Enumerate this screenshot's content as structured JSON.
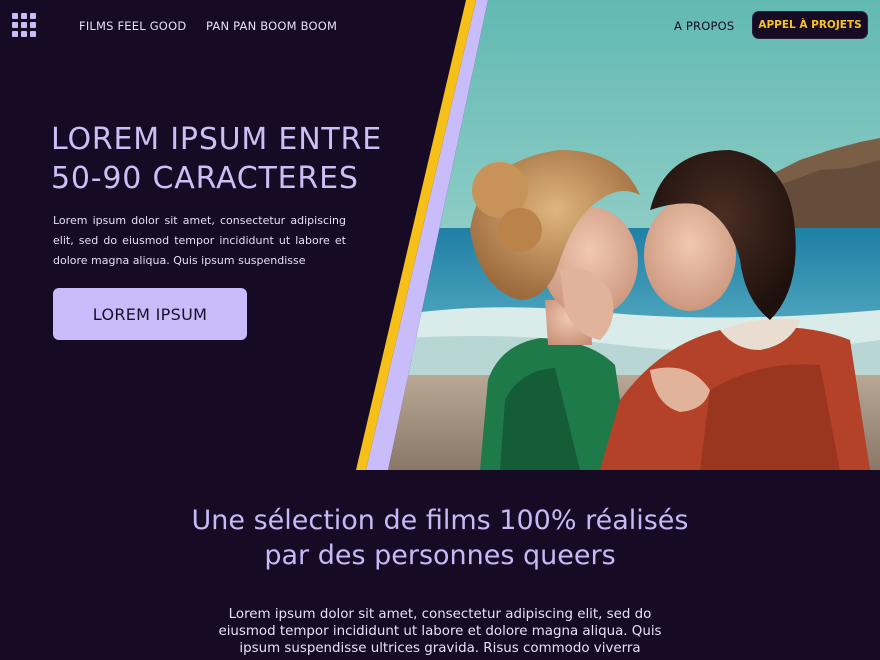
{
  "nav": {
    "menu_icon": "grid-menu-icon",
    "links": [
      "FILMS FEEL GOOD",
      "PAN PAN BOOM BOOM",
      "A PROPOS"
    ],
    "cta_label": "APPEL À PROJETS"
  },
  "hero": {
    "title_line1": "LOREM IPSUM ENTRE",
    "title_line2": "50-90 CARACTERES",
    "text": "Lorem ipsum dolor sit amet, consectetur adipiscing elit, sed do eiusmod tempor incididunt ut labore et dolore magna aliqua. Quis ipsum suspendisse",
    "button_label": "LOREM IPSUM",
    "image_alt": "two-women-embracing-on-beach"
  },
  "section": {
    "title_line1": "Une sélection de films 100% réalisés",
    "title_line2": "par des personnes queers",
    "text": "Lorem ipsum dolor sit amet, consectetur adipiscing elit, sed do eiusmod tempor incididunt ut labore et dolore magna aliqua. Quis ipsum suspendisse ultrices gravida. Risus commodo viverra"
  },
  "colors": {
    "background": "#170a24",
    "accent_lavender": "#c9bcfa",
    "accent_yellow": "#f7c51e",
    "sky": "#5cb6b4"
  }
}
